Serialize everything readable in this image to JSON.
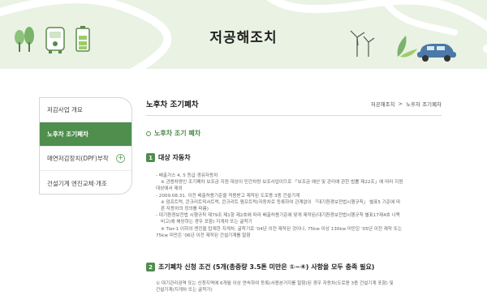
{
  "banner": {
    "title": "저공해조치"
  },
  "sidebar": {
    "items": [
      {
        "label": "저감사업 개요"
      },
      {
        "label": "노후차 조기폐차"
      },
      {
        "label": "매연저감장치(DPF)부착"
      },
      {
        "label": "건설기계 엔진교체·개조"
      }
    ],
    "expand_symbol": "+"
  },
  "main": {
    "title": "노후차 조기폐차",
    "breadcrumb": {
      "parent": "저공해조치",
      "separator": ">",
      "current": "노후차 조기폐차"
    },
    "sub_title": "노후차 조기 폐차",
    "section1": {
      "num": "1",
      "title": "대상 자동차",
      "lines": [
        "- 배출가스 4, 5 등급 경유자동차",
        "※ 관용차량인 조기폐차 보조금 지원 대상이 민간차량 보조사업이므로 「보조금 예산 및 관리에 관한 법률 제22조」에 따라 지원",
        "대상에서 제외",
        "- 2009.08.31. 이전 배출허용기준을 적용받고 제작된 도로용 3종 건설기계",
        "※ 덤프트럭, 콘크리트믹서트럭, 콘크리트 펌프트럭(자동차로 등록하여 관계없이 「대기환경보전법시행규칙」 별표5 기준에 따",
        "른 자동차의 정의를 따름)",
        "- 대기환경보전법 시행규칙 제79조 제1항 제2호에 따라 배출허용기준에 맞게 제작된(대기환경보전법시행규칙 별표17제4호 나목",
        "비고)에 해당하는 경우 포함) 지게차 또는 굴착기",
        "※ Tier-1 이하의 엔진을 탑재한 지게차, 굴착기로 '04년 이전 제작된 것이나, 75kw 이상 130kw 미만은 '05년 이전 제작 또는",
        "75kw 미만은 '06년 이전 제작된 건설기계를 말함"
      ]
    },
    "section2": {
      "num": "2",
      "title": "조기폐차 신청 조건 (5개(총중량 3.5톤 미만은 ①~④) 사항을 모두 충족 필요)",
      "lines": [
        "① 대기관리권역 또는 신청지역에 6개월 이상 연속하여 등록(사용본거지를 말함)된 경우 자동차(도로용 3종 건설기계 포함) 및",
        "건설기계(지게차 또는 굴착기)"
      ]
    }
  },
  "colors": {
    "accent": "#4f8e4d",
    "banner_bg": "#e9f2e3"
  }
}
